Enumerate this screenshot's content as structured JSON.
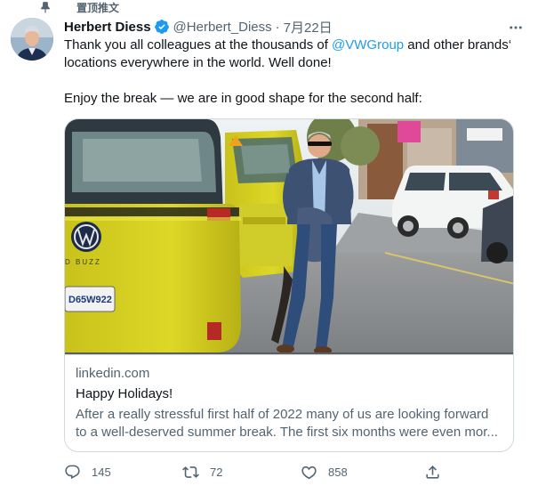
{
  "pinned": {
    "label": "置顶推文",
    "icon": "pin-icon"
  },
  "author": {
    "name": "Herbert Diess",
    "handle": "@Herbert_Diess",
    "separator": "·",
    "date": "7月22日",
    "verified_color": "#1d9bf0"
  },
  "tweet": {
    "line1_before": "Thank you all colleagues at the thousands of ",
    "mention": "@VWGroup",
    "line1_after": " and other brands‘",
    "line2": "locations everywhere in the world. Well done!",
    "line3": "Enjoy the break — we are in good shape for the second half:"
  },
  "card": {
    "domain": "linkedin.com",
    "title": "Happy Holidays!",
    "description_line1": "After a really stressful first half of 2022 many of us are looking forward",
    "description_line2": "to a well-deserved summer break.  The first six months were even mor...",
    "photo_lettering": {
      "badge": "D BUZZ",
      "plate": "D65W922"
    }
  },
  "actions": {
    "reply": {
      "icon": "reply-icon",
      "count": "145"
    },
    "retweet": {
      "icon": "retweet-icon",
      "count": "72"
    },
    "like": {
      "icon": "heart-icon",
      "count": "858"
    },
    "share": {
      "icon": "share-icon"
    }
  },
  "colors": {
    "link": "#1d9bf0",
    "secondary": "#536471",
    "border": "#cfd9de"
  }
}
